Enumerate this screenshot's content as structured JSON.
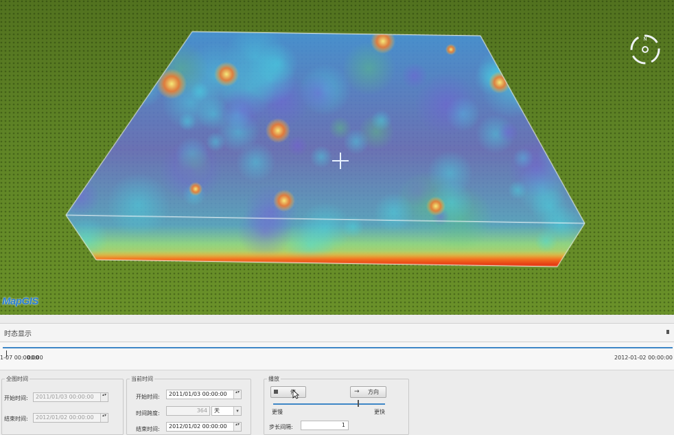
{
  "scene": {
    "logo": "MapGIS",
    "compass_label": "N",
    "crosshair_icon": "crosshair-icon",
    "colors": {
      "grass": "#5f8426",
      "bbox": "#ffffff"
    }
  },
  "panel": {
    "title": "时态显示",
    "pin_icon": "pin-icon",
    "timeline": {
      "start_label": "1-07 00:00:00",
      "start_overlap": "00:00",
      "end_label": "2012-01-02 00:00:00",
      "accent": "#3d86c6"
    },
    "full_time": {
      "legend": "全图时间",
      "start_label": "开始时间:",
      "start_value": "2011/01/03 00:00:00",
      "end_label": "结束时间:",
      "end_value": "2012/01/02 00:00:00"
    },
    "current_time": {
      "legend": "当前时间",
      "start_label": "开始时间:",
      "start_value": "2011/01/03 00:00:00",
      "span_label": "时间跨度:",
      "span_value": "364",
      "span_unit": "天",
      "end_label": "结束时间:",
      "end_value": "2012/01/02 00:00:00"
    },
    "playback": {
      "legend": "播放",
      "play_button": "停",
      "direction_button": "方向",
      "slow_label": "更慢",
      "fast_label": "更快",
      "speed_fraction": 0.75,
      "step_label": "步长间隔:",
      "step_value": "1"
    }
  }
}
